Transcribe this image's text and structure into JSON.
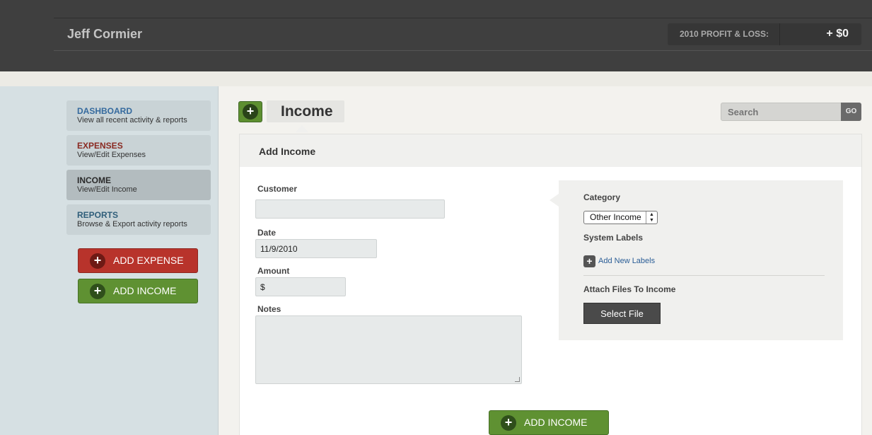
{
  "header": {
    "user_name": "Jeff Cormier",
    "pl_label": "2010 PROFIT & LOSS:",
    "pl_value": "+ $0"
  },
  "sidebar": {
    "items": [
      {
        "title": "DASHBOARD",
        "subtitle": "View all recent activity & reports"
      },
      {
        "title": "EXPENSES",
        "subtitle": "View/Edit Expenses"
      },
      {
        "title": "INCOME",
        "subtitle": "View/Edit Income"
      },
      {
        "title": "REPORTS",
        "subtitle": "Browse & Export activity reports"
      }
    ],
    "add_expense_label": "ADD EXPENSE",
    "add_income_label": "ADD INCOME"
  },
  "page": {
    "title": "Income",
    "search_placeholder": "Search",
    "search_go": "GO"
  },
  "form": {
    "panel_title": "Add Income",
    "customer_label": "Customer",
    "customer_value": "",
    "date_label": "Date",
    "date_value": "11/9/2010",
    "amount_label": "Amount",
    "amount_value": "$",
    "notes_label": "Notes",
    "category_label": "Category",
    "category_value": "Other Income",
    "system_labels_label": "System Labels",
    "add_labels_link": "Add New Labels",
    "attach_label": "Attach Files To Income",
    "select_file_label": "Select File",
    "submit_label": "ADD INCOME"
  },
  "colors": {
    "header_bg": "#3f3f3f",
    "sidebar_bg": "#d6e0e3",
    "expense_red": "#b8332b",
    "income_green": "#5f9132",
    "link_blue": "#2a5d96"
  },
  "icons": [
    "plus-icon",
    "chevron-updown-icon"
  ]
}
